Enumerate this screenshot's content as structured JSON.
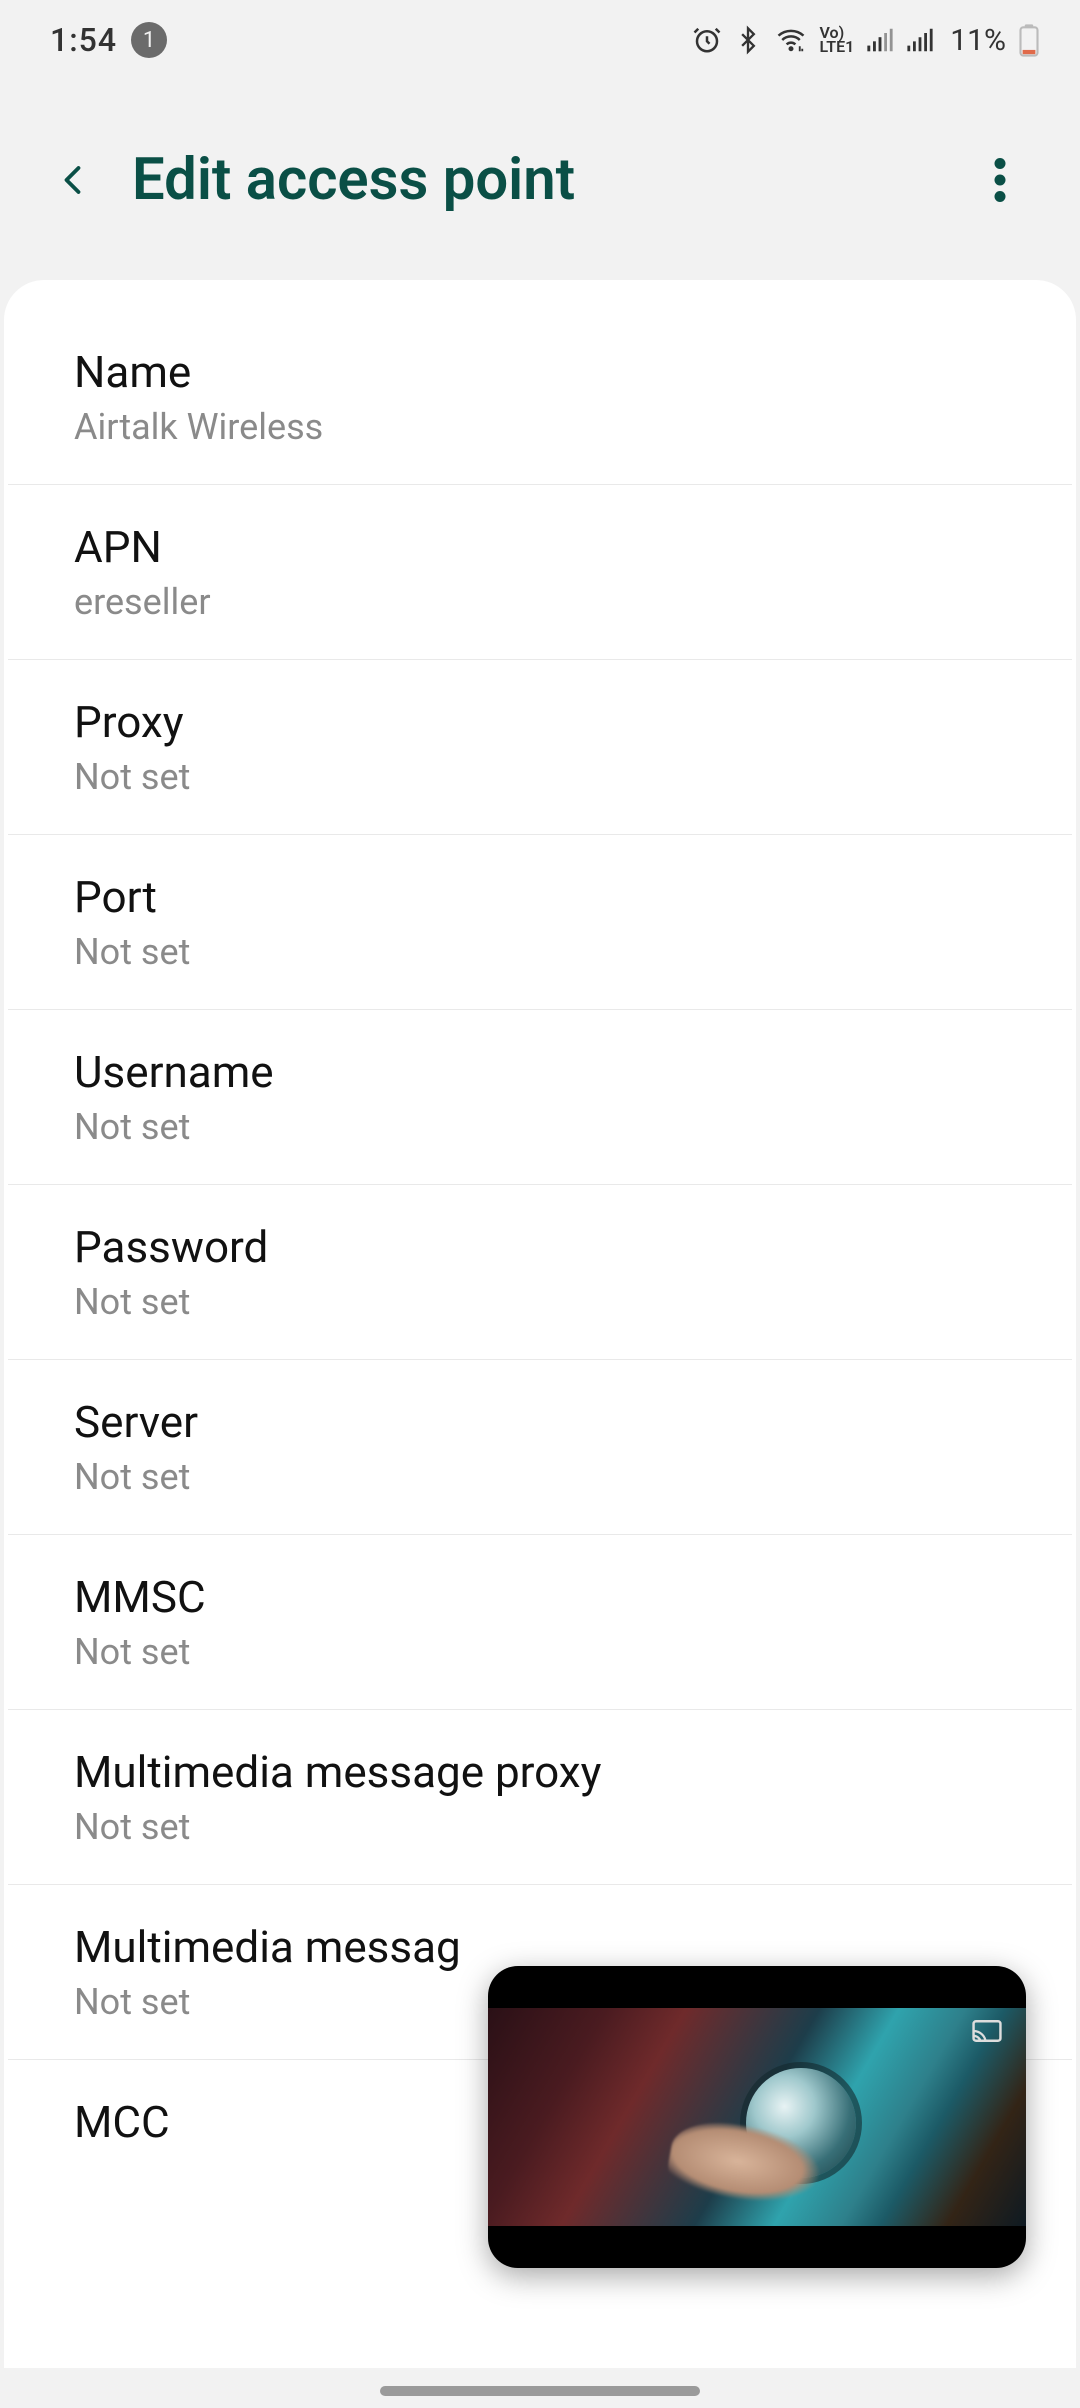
{
  "status": {
    "time": "1:54",
    "notification_count": "1",
    "battery_percent": "11%"
  },
  "header": {
    "title": "Edit access point"
  },
  "items": [
    {
      "label": "Name",
      "value": "Airtalk Wireless"
    },
    {
      "label": "APN",
      "value": "ereseller"
    },
    {
      "label": "Proxy",
      "value": "Not set"
    },
    {
      "label": "Port",
      "value": "Not set"
    },
    {
      "label": "Username",
      "value": "Not set"
    },
    {
      "label": "Password",
      "value": "Not set"
    },
    {
      "label": "Server",
      "value": "Not set"
    },
    {
      "label": "MMSC",
      "value": "Not set"
    },
    {
      "label": "Multimedia message proxy",
      "value": "Not set"
    },
    {
      "label": "Multimedia messag",
      "value": "Not set"
    },
    {
      "label": "MCC",
      "value": ""
    }
  ]
}
